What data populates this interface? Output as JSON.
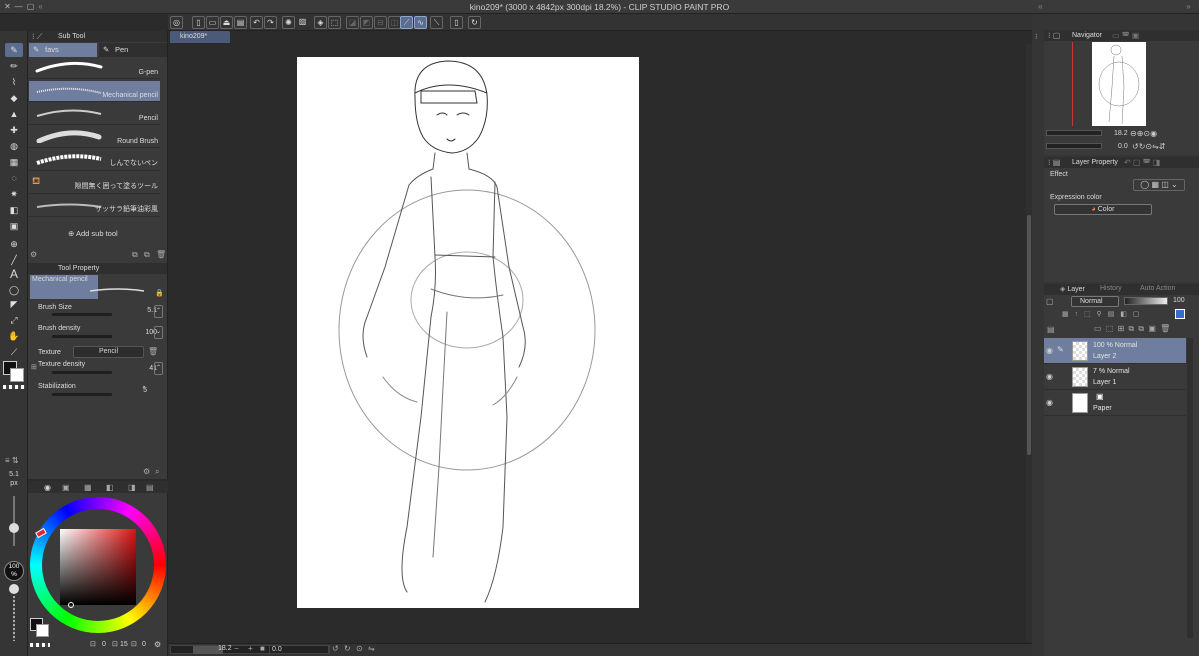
{
  "window": {
    "title": "kino209* (3000 x 4842px 300dpi 18.2%)  - CLIP STUDIO PAINT PRO"
  },
  "document_tab": "kino209*",
  "sub_tool_panel": {
    "title": "Sub Tool",
    "tabs": [
      "favs",
      "Pen"
    ],
    "brushes": [
      "G-pen",
      "Mechanical pencil",
      "Pencil",
      "Round Brush",
      "しんでないペン",
      "隙間無く囲って塗るツール",
      "ザッサラ鉛筆油彩風"
    ],
    "add_label": "Add sub tool"
  },
  "tool_property": {
    "title": "Tool Property",
    "brush_name": "Mechanical pencil",
    "props": [
      {
        "label": "Brush Size",
        "value": "5.1"
      },
      {
        "label": "Brush density",
        "value": "100"
      },
      {
        "label": "Texture",
        "value": "Pencil"
      },
      {
        "label": "Texture density",
        "value": "41"
      },
      {
        "label": "Stabilization",
        "value": "5"
      }
    ]
  },
  "left_strip": {
    "size_value": "5.1",
    "size_unit": "px",
    "opacity_value": "100",
    "opacity_unit": "%"
  },
  "color_panel": {
    "vals": [
      "0",
      "15",
      "0"
    ]
  },
  "status_bar": {
    "zoom": "18.2",
    "angle": "0.0"
  },
  "navigator": {
    "title": "Navigator",
    "zoom": "18.2",
    "angle": "0.0"
  },
  "layer_property": {
    "title": "Layer Property",
    "effect_label": "Effect",
    "expression_label": "Expression color",
    "expression_value": "Color"
  },
  "layer_panel": {
    "tabs": [
      "Layer",
      "History",
      "Auto Action"
    ],
    "blend_mode": "Normal",
    "opacity": "100",
    "layers": [
      {
        "mode": "100 % Normal",
        "name": "Layer 2",
        "selected": true
      },
      {
        "mode": "7 % Normal",
        "name": "Layer 1",
        "selected": false
      },
      {
        "mode": "",
        "name": "Paper",
        "selected": false
      }
    ]
  },
  "colors": {
    "accent": "#5b6e8f",
    "selected_row": "#6f7e9e",
    "panel_bg": "#3a3a3a",
    "canvas_bg": "#2b2b2b"
  }
}
